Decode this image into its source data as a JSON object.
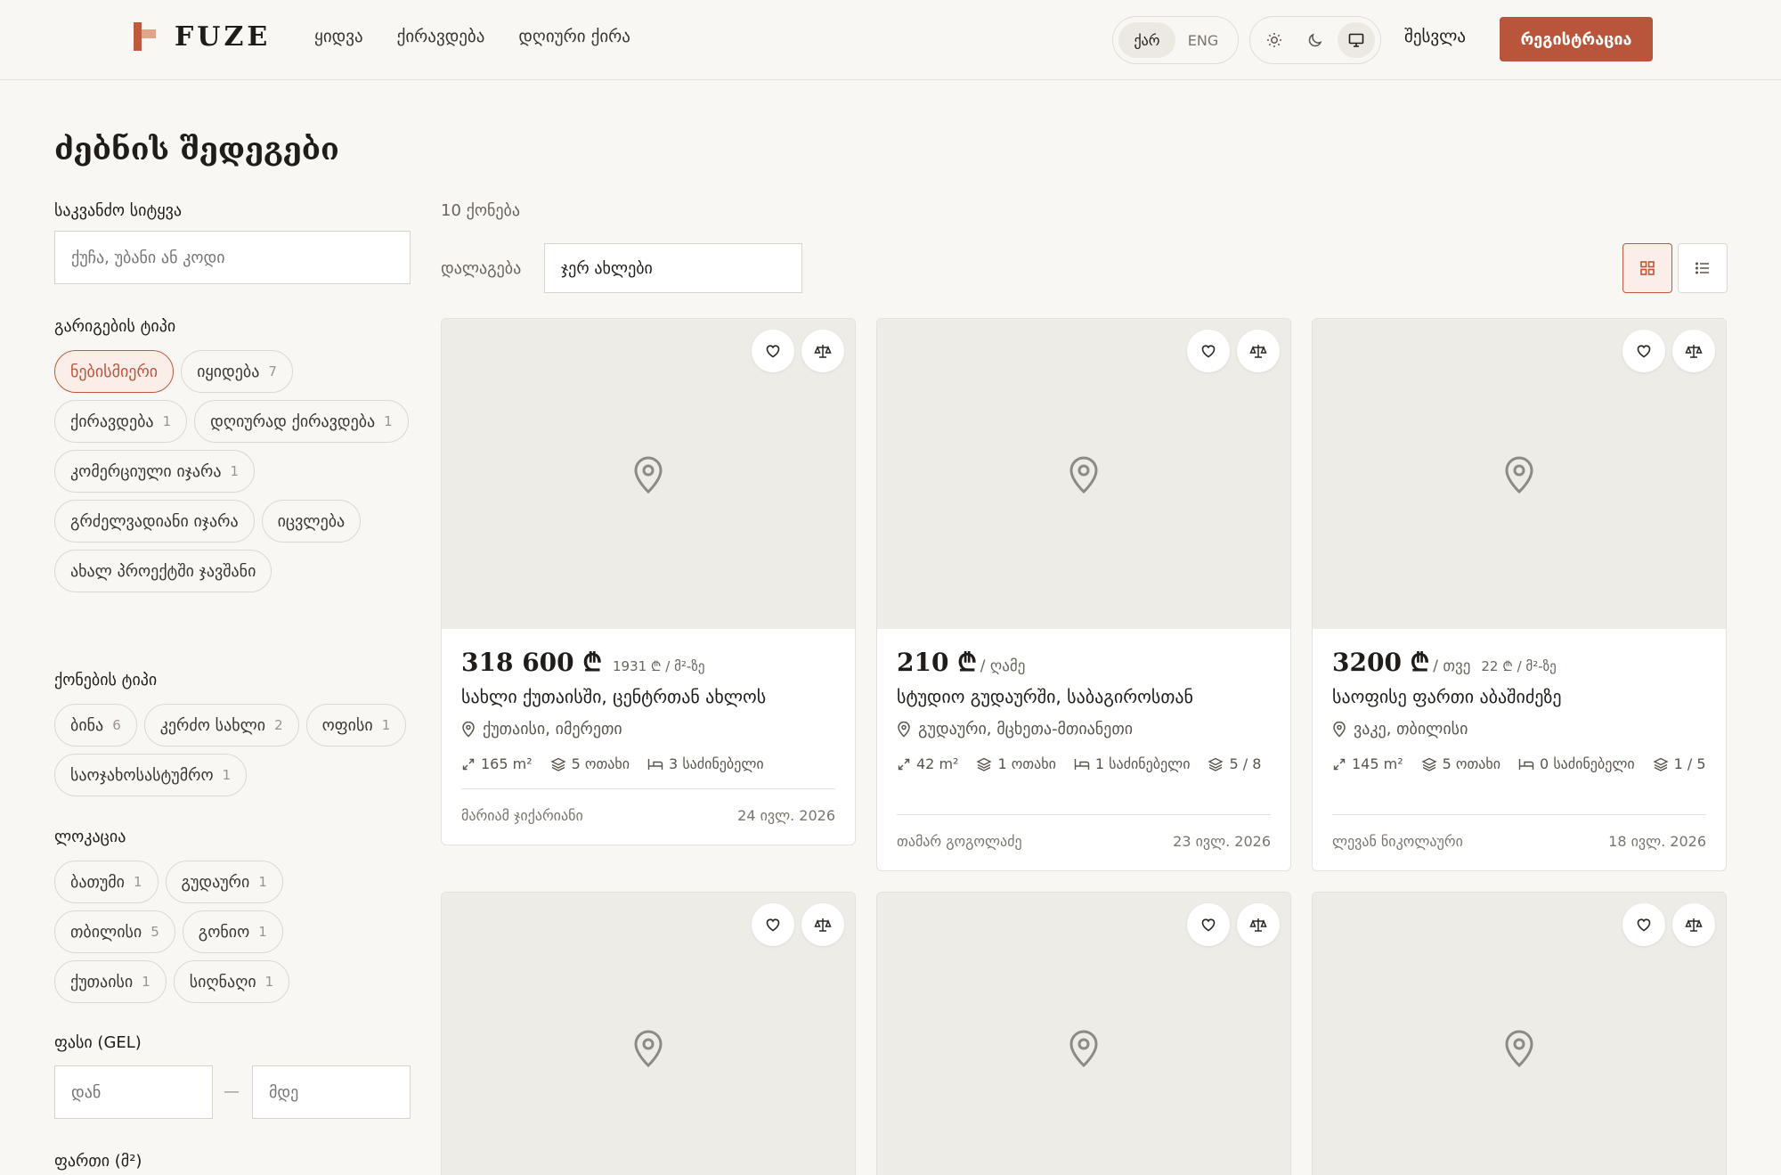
{
  "header": {
    "logo_text": "FUZE",
    "nav": [
      "ყიდვა",
      "ქირავდება",
      "დღიური ქირა"
    ],
    "lang": {
      "active": "ქარ",
      "other": "ENG"
    },
    "login": "შესვლა",
    "register": "რეგისტრაცია",
    "accent_color": "#b9553a"
  },
  "page_title": "ძებნის შედეგები",
  "sidebar": {
    "keyword_label": "საკვანძო სიტყვა",
    "keyword_placeholder": "ქუჩა, უბანი ან კოდი",
    "deal_type_label": "გარიგების ტიპი",
    "deal_types": [
      {
        "label": "ნებისმიერი",
        "count": "",
        "active": true
      },
      {
        "label": "იყიდება",
        "count": "7"
      },
      {
        "label": "ქირავდება",
        "count": "1"
      },
      {
        "label": "დღიურად ქირავდება",
        "count": "1"
      },
      {
        "label": "კომერციული იჯარა",
        "count": "1"
      },
      {
        "label": "გრძელვადიანი იჯარა",
        "count": ""
      },
      {
        "label": "იცვლება",
        "count": ""
      },
      {
        "label": "ახალ პროექტში ჯავშანი",
        "count": ""
      }
    ],
    "property_type_label": "ქონების ტიპი",
    "property_types": [
      {
        "label": "ბინა",
        "count": "6"
      },
      {
        "label": "კერძო სახლი",
        "count": "2"
      },
      {
        "label": "ოფისი",
        "count": "1"
      },
      {
        "label": "სასტუმრო",
        "count": "1",
        "prefix": "საოჯახო "
      }
    ],
    "location_label": "ლოკაცია",
    "locations": [
      {
        "label": "ბათუმი",
        "count": "1"
      },
      {
        "label": "გუდაური",
        "count": "1"
      },
      {
        "label": "თბილისი",
        "count": "5"
      },
      {
        "label": "გონიო",
        "count": "1"
      },
      {
        "label": "ქუთაისი",
        "count": "1"
      },
      {
        "label": "სიღნაღი",
        "count": "1"
      }
    ],
    "price_label": "ფასი (GEL)",
    "price_from": "დან",
    "price_to": "მდე",
    "area_label": "ფართი (მ²)"
  },
  "results": {
    "count": "10 ქონება",
    "sort_label": "დალაგება",
    "sort_value": "ჯერ ახლები"
  },
  "cards": [
    {
      "price": "318 600 ₾",
      "period": "",
      "ppm": "1931 ₾ / მ²-ზე",
      "title": "სახლი ქუთაისში, ცენტრთან ახლოს",
      "location": "ქუთაისი, იმერეთი",
      "area": "165 m²",
      "rooms": "5 ოთახი",
      "bedrooms": "3 საძინებელი",
      "floor": "",
      "agent": "მარიამ ჯიქარიანი",
      "date": "24 ივლ. 2026"
    },
    {
      "price": "210 ₾",
      "period": "/ ღამე",
      "ppm": "",
      "title": "სტუდიო გუდაურში, საბაგიროსთან",
      "location": "გუდაური, მცხეთა-მთიანეთი",
      "area": "42 m²",
      "rooms": "1 ოთახი",
      "bedrooms": "1 საძინებელი",
      "floor": "5 / 8",
      "agent": "თამარ გოგოლაძე",
      "date": "23 ივლ. 2026"
    },
    {
      "price": "3200 ₾",
      "period": "/ თვე",
      "ppm": "22 ₾ / მ²-ზე",
      "title": "საოფისე ფართი აბაშიძეზე",
      "location": "ვაკე, თბილისი",
      "area": "145 m²",
      "rooms": "5 ოთახი",
      "bedrooms": "0 საძინებელი",
      "floor": "1 / 5",
      "agent": "ლევან ნიკოლაური",
      "date": "18 ივლ. 2026"
    },
    {
      "price": "",
      "title": ""
    },
    {
      "price": "",
      "title": ""
    },
    {
      "price": "",
      "title": ""
    }
  ],
  "icons": {
    "favorite": "heart-icon",
    "compare": "scale-icon",
    "placeholder": "map-pin-icon",
    "grid_view": "grid-icon",
    "list_view": "list-icon"
  }
}
